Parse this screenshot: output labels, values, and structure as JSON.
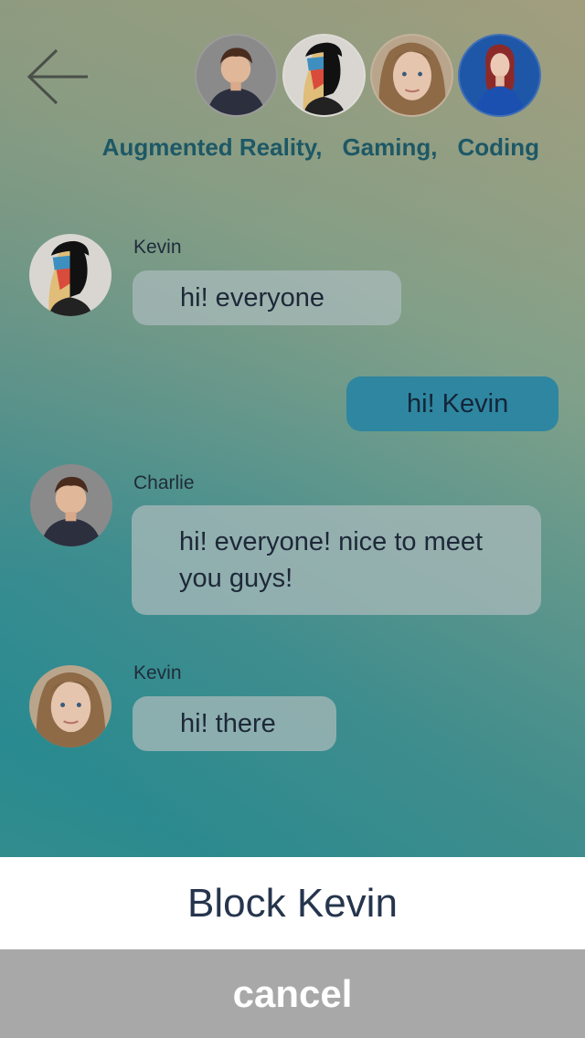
{
  "header": {
    "back_icon": "arrow-left-icon",
    "participants": [
      {
        "name": "Charlie",
        "icon": "avatar-charlie",
        "bg": "#8a8a8a"
      },
      {
        "name": "Kevin",
        "icon": "avatar-kevin",
        "bg": "#d9d6d2"
      },
      {
        "name": "member-3",
        "icon": "avatar-woman-blonde",
        "bg": "#b9a58b"
      },
      {
        "name": "member-4",
        "icon": "avatar-woman-redhead",
        "bg": "#1f57a8"
      }
    ],
    "topics": [
      "Augmented Reality,",
      "Gaming,",
      "Coding"
    ]
  },
  "messages": [
    {
      "sender": "Kevin",
      "text": "hi! everyone",
      "mine": false
    },
    {
      "sender": "",
      "text": "hi! Kevin",
      "mine": true
    },
    {
      "sender": "Charlie",
      "text": "hi! everyone! nice to meet you guys!",
      "mine": false
    },
    {
      "sender": "Kevin",
      "text": "hi! there",
      "mine": false
    }
  ],
  "action_sheet": {
    "block_label": "Block Kevin",
    "cancel_label": "cancel"
  },
  "colors": {
    "topic_text": "#1d5866",
    "mine_bubble": "#2f86a0",
    "other_bubble": "#aab9b9",
    "sheet_bg": "#ffffff",
    "cancel_bg": "#a8a8a8"
  }
}
